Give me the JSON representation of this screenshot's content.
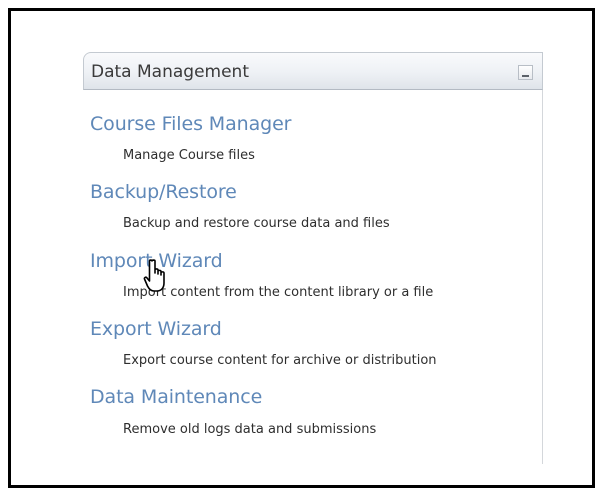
{
  "panel": {
    "title": "Data Management",
    "collapse_icon": "minimize-icon",
    "items": [
      {
        "label": "Course Files Manager",
        "description": "Manage Course files"
      },
      {
        "label": "Backup/Restore",
        "description": "Backup and restore course data and files"
      },
      {
        "label": "Import Wizard",
        "description": "Import content from the content library or a file"
      },
      {
        "label": "Export Wizard",
        "description": "Export course content for archive or distribution"
      },
      {
        "label": "Data Maintenance",
        "description": "Remove old logs data and submissions"
      }
    ]
  },
  "colors": {
    "link": "#5f88b8",
    "text": "#2e2e2e",
    "frame_border": "#000000"
  },
  "cursor": {
    "icon": "hand-pointer-icon"
  }
}
